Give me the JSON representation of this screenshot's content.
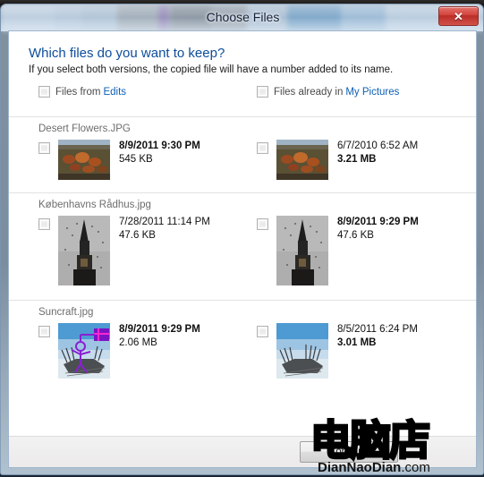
{
  "window": {
    "title": "Choose Files",
    "close_label": "✕",
    "close_icon": "close-icon"
  },
  "header": {
    "question": "Which files do you want to keep?",
    "instruction": "If you select both versions, the copied file will have a number added to its name."
  },
  "columns": [
    {
      "prefix": "Files from",
      "link": "Edits",
      "checked": false
    },
    {
      "prefix": "Files already in",
      "link": "My Pictures",
      "checked": false
    }
  ],
  "file_groups": [
    {
      "name": "Desert Flowers.JPG",
      "thumb": "desert-flowers",
      "left": {
        "date": "8/9/2011 9:30 PM",
        "date_bold": true,
        "size": "545 KB",
        "size_bold": false,
        "checked": false
      },
      "right": {
        "date": "6/7/2010 6:52 AM",
        "date_bold": false,
        "size": "3.21 MB",
        "size_bold": true,
        "checked": false
      }
    },
    {
      "name": "Københavns Rådhus.jpg",
      "thumb": "copenhagen-spire",
      "left": {
        "date": "7/28/2011 11:14 PM",
        "date_bold": false,
        "size": "47.6 KB",
        "size_bold": false,
        "checked": false
      },
      "right": {
        "date": "8/9/2011 9:29 PM",
        "date_bold": true,
        "size": "47.6 KB",
        "size_bold": false,
        "checked": false
      }
    },
    {
      "name": "Suncraft.jpg",
      "thumb": "suncraft",
      "left": {
        "date": "8/9/2011 9:29 PM",
        "date_bold": true,
        "size": "2.06 MB",
        "size_bold": false,
        "checked": false
      },
      "right": {
        "date": "8/5/2011 6:24 PM",
        "date_bold": false,
        "size": "3.01 MB",
        "size_bold": true,
        "checked": false
      }
    }
  ],
  "footer": {
    "continue_label": "Continue"
  },
  "watermark": {
    "chinese": "电脑店",
    "latin": "DianNaoDian",
    "suffix": ".com"
  },
  "colors": {
    "heading_blue": "#0d4d9b",
    "link_blue": "#0e5fb5",
    "glass_blue": "#cfe3f6",
    "close_red": "#c8332c"
  }
}
